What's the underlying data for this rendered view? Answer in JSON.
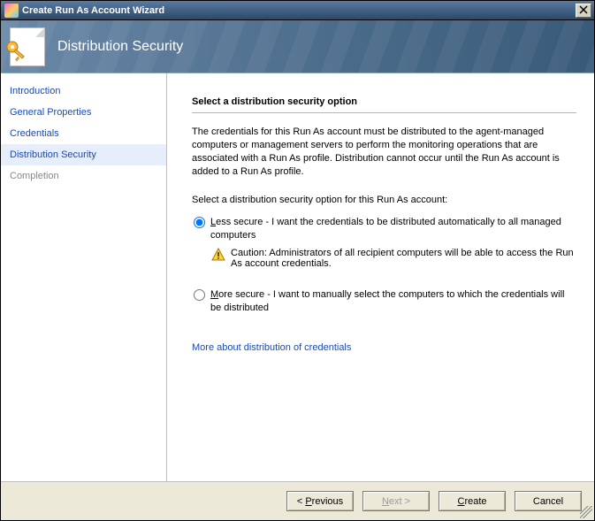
{
  "window": {
    "title": "Create Run As Account Wizard"
  },
  "banner": {
    "title": "Distribution Security"
  },
  "sidebar": {
    "items": [
      {
        "label": "Introduction",
        "active": false,
        "disabled": false
      },
      {
        "label": "General Properties",
        "active": false,
        "disabled": false
      },
      {
        "label": "Credentials",
        "active": false,
        "disabled": false
      },
      {
        "label": "Distribution Security",
        "active": true,
        "disabled": false
      },
      {
        "label": "Completion",
        "active": false,
        "disabled": true
      }
    ]
  },
  "main": {
    "heading": "Select a distribution security option",
    "description": "The credentials for this Run As account must be distributed to the agent-managed computers or management servers to perform the monitoring operations that are associated with a Run As profile.  Distribution cannot occur until the Run As account is added to a Run As profile.",
    "prompt": "Select a distribution security option for this Run As account:",
    "option1": {
      "prefixLetter": "L",
      "rest": "ess secure - I want the credentials to be distributed automatically to all managed computers",
      "checked": true,
      "caution": "Caution: Administrators of all recipient computers will be able to access the Run As account credentials."
    },
    "option2": {
      "prefixLetter": "M",
      "rest": "ore secure - I want to manually select the computers to which the credentials will be distributed",
      "checked": false
    },
    "link": "More about distribution of credentials"
  },
  "footer": {
    "previous": {
      "prefix": "< ",
      "letter": "P",
      "rest": "revious"
    },
    "next": {
      "letter": "N",
      "rest": "ext >"
    },
    "create": {
      "letter": "C",
      "rest": "reate"
    },
    "cancel": {
      "label": "Cancel"
    }
  }
}
